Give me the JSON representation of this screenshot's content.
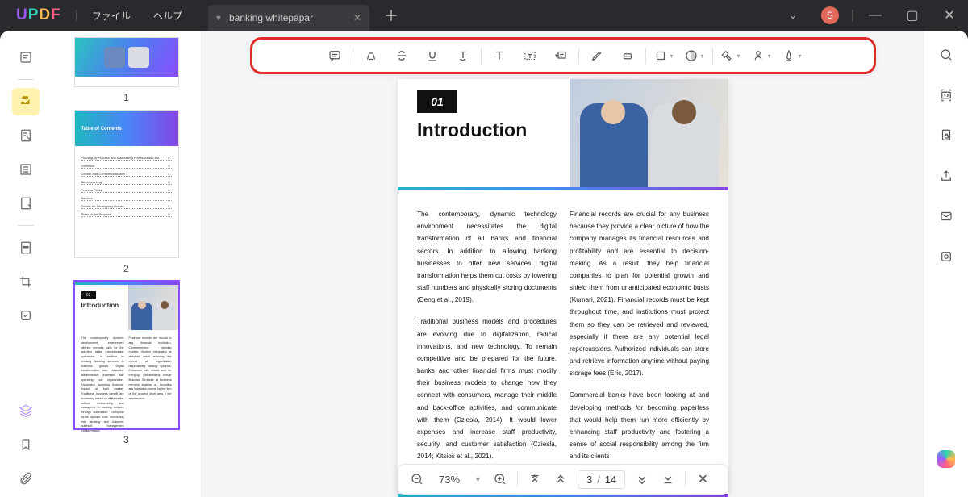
{
  "titlebar": {
    "logo": "UPDF",
    "menu_file": "ファイル",
    "menu_help": "ヘルプ",
    "tab_title": "banking whitepapar",
    "avatar_letter": "S"
  },
  "left_rail": {
    "items": [
      {
        "name": "reader",
        "active": false
      },
      {
        "name": "comment",
        "active": true
      },
      {
        "name": "edit",
        "active": false
      },
      {
        "name": "page-layout",
        "active": false
      },
      {
        "name": "fill-sign",
        "active": false
      },
      {
        "name": "redact",
        "active": false
      },
      {
        "name": "crop",
        "active": false
      },
      {
        "name": "organize",
        "active": false
      }
    ],
    "bottom": [
      {
        "name": "layers"
      },
      {
        "name": "bookmark"
      },
      {
        "name": "attachment"
      }
    ]
  },
  "thumbnails": [
    {
      "num": "1",
      "active": false,
      "kind": "cover"
    },
    {
      "num": "2",
      "active": false,
      "kind": "toc",
      "title": "Table of Contents"
    },
    {
      "num": "3",
      "active": true,
      "kind": "intro"
    }
  ],
  "annotation_tools": [
    "comment",
    "highlight",
    "strikethrough",
    "underline",
    "squiggly",
    "text",
    "textbox",
    "callout",
    "pencil",
    "eraser",
    "shape",
    "sticker",
    "stamp",
    "signature",
    "manage"
  ],
  "document": {
    "chapter_badge": "01",
    "title": "Introduction",
    "col1_p1": "The contemporary, dynamic technology environment necessitates the digital transformation of all banks and financial sectors. In addition to allowing banking businesses to offer new services, digital transformation helps them cut costs by lowering staff numbers and physically storing documents (Deng et al., 2019).",
    "col1_p2": "Traditional business models and procedures are evolving due to digitalization, radical innovations, and new technology. To remain competitive and be prepared for the future, banks and other financial firms must modify their business models to change how they connect with consumers, manage their middle and back-office activities, and communicate with them (Cziesla, 2014). It would lower expenses and increase staff productivity, security, and customer satisfaction (Cziesla, 2014; Kitsios et al., 2021).",
    "col2_p1": "Financial records are crucial for any business because they provide a clear picture of how the company manages its financial resources and profitability and are essential to decision-making. As a result, they help financial companies to plan for potential growth and shield them from unanticipated economic busts (Kumari, 2021). Financial records must be kept throughout time, and institutions must protect them so they can be retrieved and reviewed, especially if there are any potential legal repercussions. Authorized individuals can store and retrieve information anytime without paying storage fees (Eric, 2017).",
    "col2_p2": "Commercial banks have been looking at and developing methods for becoming paperless that would help them run more efficiently by enhancing staff productivity and fostering a sense of social responsibility among the firm and its clients"
  },
  "page_nav": {
    "zoom": "73%",
    "current": "3",
    "separator": "/",
    "total": "14"
  },
  "right_rail": [
    "search",
    "ocr",
    "protect",
    "share",
    "email",
    "flatten"
  ]
}
